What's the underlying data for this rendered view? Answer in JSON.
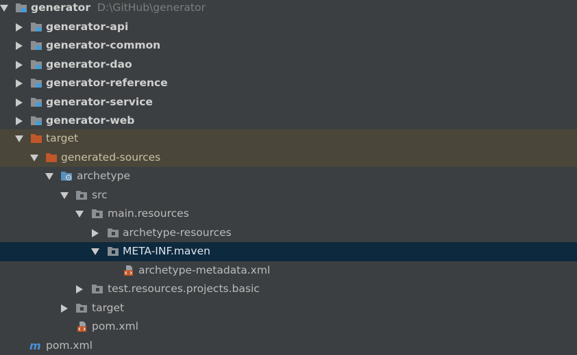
{
  "tree": {
    "root": {
      "label": "generator",
      "path": "D:\\GitHub\\generator",
      "icon": "module-folder-icon",
      "expanded": true
    },
    "modules": [
      {
        "label": "generator-api",
        "icon": "module-folder-icon"
      },
      {
        "label": "generator-common",
        "icon": "module-folder-icon"
      },
      {
        "label": "generator-dao",
        "icon": "module-folder-icon"
      },
      {
        "label": "generator-reference",
        "icon": "module-folder-icon"
      },
      {
        "label": "generator-service",
        "icon": "module-folder-icon"
      },
      {
        "label": "generator-web",
        "icon": "module-folder-icon"
      }
    ],
    "target": {
      "label": "target",
      "icon": "excluded-folder-icon",
      "expanded": true
    },
    "generated_sources": {
      "label": "generated-sources",
      "icon": "excluded-folder-icon",
      "expanded": true
    },
    "archetype": {
      "label": "archetype",
      "icon": "archetype-folder-icon",
      "expanded": true
    },
    "src": {
      "label": "src",
      "icon": "folder-icon",
      "expanded": true
    },
    "main_resources": {
      "label": "main.resources",
      "icon": "folder-icon",
      "expanded": true
    },
    "archetype_resources": {
      "label": "archetype-resources",
      "icon": "folder-icon",
      "expanded": false
    },
    "meta_inf": {
      "label": "META-INF.maven",
      "icon": "folder-icon",
      "expanded": true,
      "selected": true
    },
    "archetype_metadata": {
      "label": "archetype-metadata.xml",
      "icon": "xml-file-icon"
    },
    "test_resources": {
      "label": "test.resources.projects.basic",
      "icon": "folder-icon",
      "expanded": false
    },
    "inner_target": {
      "label": "target",
      "icon": "folder-icon",
      "expanded": false
    },
    "inner_pom": {
      "label": "pom.xml",
      "icon": "xml-file-icon"
    },
    "root_pom": {
      "label": "pom.xml",
      "icon": "maven-m-icon"
    }
  },
  "colors": {
    "background": "#3c3f41",
    "excluded_row": "#4a4639",
    "selected_row": "#0d293e",
    "module_blue": "#3d9ee0",
    "excluded_orange": "#c0572a",
    "folder_gray": "#8a8f93",
    "maven_blue": "#4a8fd6"
  }
}
